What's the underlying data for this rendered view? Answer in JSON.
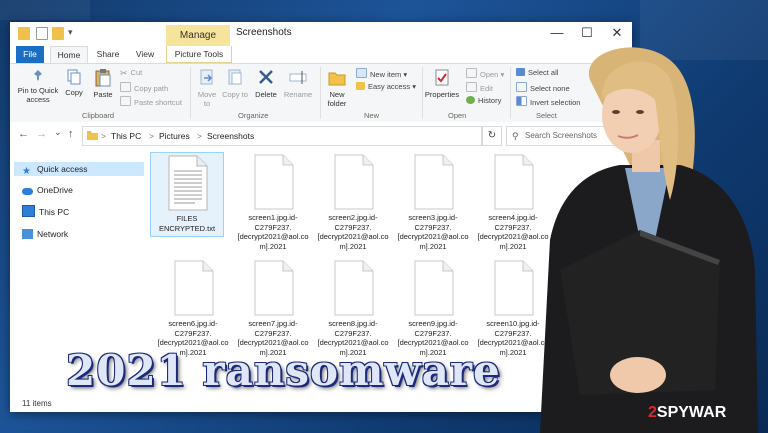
{
  "window": {
    "manage_tab": "Manage",
    "title": "Screenshots",
    "controls": {
      "minimize": "—",
      "maximize": "☐",
      "close": "✕"
    }
  },
  "tabs": {
    "file": "File",
    "home": "Home",
    "share": "Share",
    "view": "View",
    "picture_tools": "Picture Tools"
  },
  "ribbon": {
    "clipboard": {
      "pin": "Pin to Quick access",
      "copy": "Copy",
      "paste": "Paste",
      "cut": "Cut",
      "copy_path": "Copy path",
      "paste_shortcut": "Paste shortcut",
      "label": "Clipboard"
    },
    "organize": {
      "move_to": "Move to",
      "copy_to": "Copy to",
      "delete": "Delete",
      "rename": "Rename",
      "label": "Organize"
    },
    "new": {
      "new_folder": "New folder",
      "new_item": "New item",
      "easy_access": "Easy access",
      "label": "New"
    },
    "open": {
      "properties": "Properties",
      "open": "Open",
      "edit": "Edit",
      "history": "History",
      "label": "Open"
    },
    "select": {
      "select_all": "Select all",
      "select_none": "Select none",
      "invert_selection": "Invert selection",
      "label": "Select"
    }
  },
  "address": {
    "back": "←",
    "forward": "→",
    "recent": "⌄",
    "up": "↑",
    "path": [
      "This PC",
      "Pictures",
      "Screenshots"
    ],
    "separator": ">",
    "refresh": "↻",
    "search_placeholder": "Search Screenshots"
  },
  "nav": {
    "items": [
      {
        "label": "Quick access",
        "icon": "star-icon"
      },
      {
        "label": "OneDrive",
        "icon": "cloud-icon"
      },
      {
        "label": "This PC",
        "icon": "computer-icon"
      },
      {
        "label": "Network",
        "icon": "network-icon"
      }
    ]
  },
  "files": [
    {
      "name": "FILES ENCRYPTED.txt"
    },
    {
      "name": "screen1.jpg.id-C279F237.[decrypt2021@aol.com].2021"
    },
    {
      "name": "screen2.jpg.id-C279F237.[decrypt2021@aol.com].2021"
    },
    {
      "name": "screen3.jpg.id-C279F237.[decrypt2021@aol.com].2021"
    },
    {
      "name": "screen4.jpg.id-C279F237.[decrypt2021@aol.com].2021"
    },
    {
      "name": "screen6.jpg.id-C279F237.[decrypt2021@aol.com].2021"
    },
    {
      "name": "screen7.jpg.id-C279F237.[decrypt2021@aol.com].2021"
    },
    {
      "name": "screen8.jpg.id-C279F237.[decrypt2021@aol.com].2021"
    },
    {
      "name": "screen9.jpg.id-C279F237.[decrypt2021@aol.com].2021"
    },
    {
      "name": "screen10.jpg.id-C279F237.[decrypt2021@aol.com].2021"
    }
  ],
  "status": {
    "count": "11 items"
  },
  "overlay": {
    "headline": "2021 ransomware",
    "logo_prefix": "2",
    "logo_rest": "SPYWAR"
  }
}
